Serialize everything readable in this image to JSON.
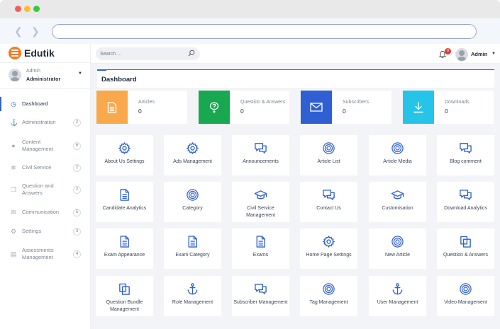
{
  "app": {
    "name": "Edutik"
  },
  "sidebar": {
    "user": {
      "role": "Admin",
      "name": "Administrator"
    },
    "items": [
      {
        "label": "Dashboard",
        "icon": "dashboard-icon",
        "badge": null,
        "active": true
      },
      {
        "label": "Administration",
        "icon": "anchor-icon",
        "badge": "2"
      },
      {
        "label": "Content Management",
        "icon": "circle-icon",
        "badge": "6"
      },
      {
        "label": "Civil Service",
        "icon": "graduation-cap-icon",
        "badge": "2"
      },
      {
        "label": "Question and Answers",
        "icon": "copy-icon",
        "badge": "2"
      },
      {
        "label": "Communication",
        "icon": "chat-icon",
        "badge": "5"
      },
      {
        "label": "Settings",
        "icon": "gear-icon",
        "badge": "3"
      },
      {
        "label": "Assessments Management",
        "icon": "document-icon",
        "badge": "4"
      }
    ]
  },
  "header": {
    "search_placeholder": "Search ...",
    "notification_count": "0",
    "user_name": "Admin"
  },
  "main": {
    "title": "Dashboard",
    "stats": [
      {
        "label": "Articles",
        "value": "0",
        "color": "#f9a94b",
        "icon": "document-icon"
      },
      {
        "label": "Question & Answers",
        "value": "0",
        "color": "#18a84f",
        "icon": "question-bubble-icon"
      },
      {
        "label": "Subscribers",
        "value": "0",
        "color": "#2f5fd3",
        "icon": "mail-icon"
      },
      {
        "label": "Downloads",
        "value": "0",
        "color": "#27c4ea",
        "icon": "download-icon"
      }
    ],
    "cards": [
      {
        "label": "About Us Settings",
        "icon": "gear"
      },
      {
        "label": "Ads Management",
        "icon": "gear"
      },
      {
        "label": "Announcements",
        "icon": "chat"
      },
      {
        "label": "Article List",
        "icon": "target"
      },
      {
        "label": "Article Media",
        "icon": "target"
      },
      {
        "label": "Blog comment",
        "icon": "chat"
      },
      {
        "label": "Candidate Analytics",
        "icon": "document"
      },
      {
        "label": "Category",
        "icon": "target"
      },
      {
        "label": "Civil Service Management",
        "icon": "graduation"
      },
      {
        "label": "Contact Us",
        "icon": "chat"
      },
      {
        "label": "Customisation",
        "icon": "graduation"
      },
      {
        "label": "Download Analytics",
        "icon": "chat"
      },
      {
        "label": "Exam Appearance",
        "icon": "document"
      },
      {
        "label": "Exam Category",
        "icon": "document"
      },
      {
        "label": "Exams",
        "icon": "document"
      },
      {
        "label": "Home Page Settings",
        "icon": "gear"
      },
      {
        "label": "New Article",
        "icon": "target"
      },
      {
        "label": "Question & Answers",
        "icon": "copy"
      },
      {
        "label": "Question Bundle Management",
        "icon": "copy"
      },
      {
        "label": "Role Management",
        "icon": "anchor"
      },
      {
        "label": "Subscriber Management",
        "icon": "chat"
      },
      {
        "label": "Tag Management",
        "icon": "target"
      },
      {
        "label": "User Management",
        "icon": "anchor"
      },
      {
        "label": "Video Management",
        "icon": "target"
      }
    ]
  },
  "colors": {
    "accent": "#2f62c9",
    "brand": "#f47b20",
    "background": "#f2f4f7"
  }
}
